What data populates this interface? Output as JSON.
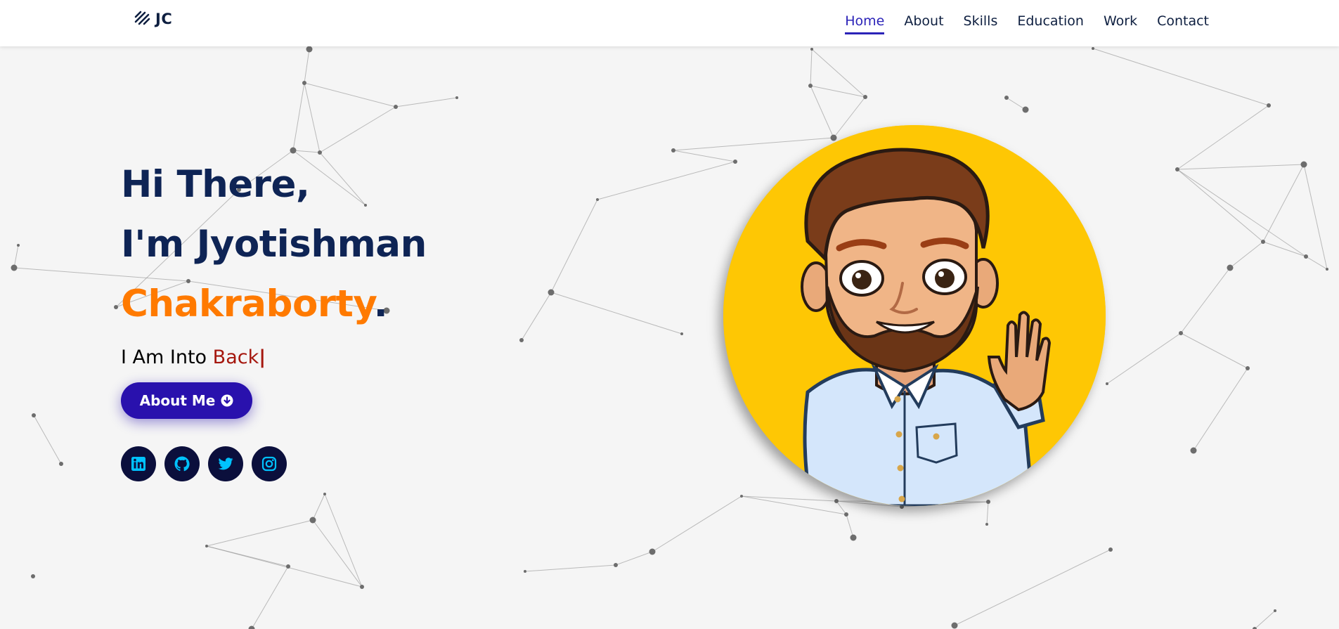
{
  "nav": {
    "brand": "JC",
    "links": [
      "Home",
      "About",
      "Skills",
      "Education",
      "Work",
      "Contact"
    ],
    "active": "Home"
  },
  "hero": {
    "greeting_line1": "Hi There,",
    "greeting_line2": "I'm Jyotishman",
    "greeting_line3": "Chakraborty",
    "greeting_period": ".",
    "typed_prefix": "I Am Into ",
    "typed_word": "Back",
    "cursor": "|",
    "button_label": "About Me"
  },
  "socials": [
    "linkedin-icon",
    "github-icon",
    "twitter-icon",
    "instagram-icon"
  ],
  "colors": {
    "nav_text": "#0e1f40",
    "active_link": "#2b23b8",
    "heading": "#0e2455",
    "name_accent": "#ff7a00",
    "typed_accent": "#a5170e",
    "button": "#2911ad",
    "social_bg": "#0b0f3c",
    "social_icon": "#00c2ff",
    "avatar_bg": "#fec704",
    "page_bg": "#f5f5f5"
  }
}
